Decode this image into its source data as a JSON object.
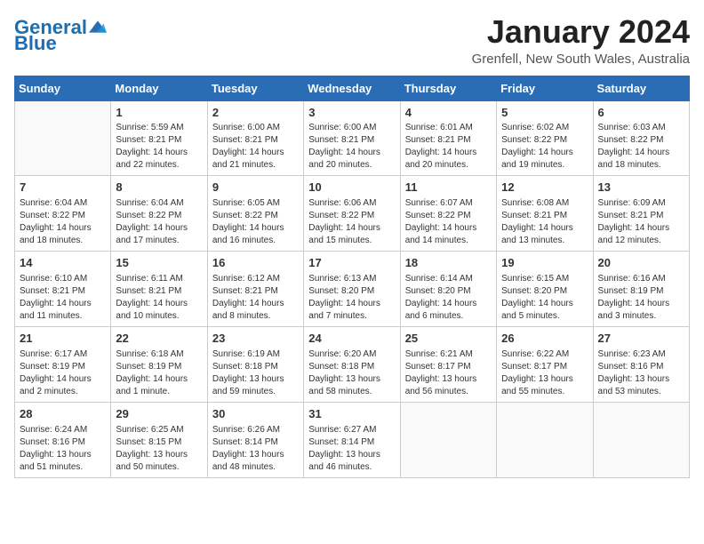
{
  "logo": {
    "line1": "General",
    "line2": "Blue"
  },
  "title": "January 2024",
  "subtitle": "Grenfell, New South Wales, Australia",
  "days_header": [
    "Sunday",
    "Monday",
    "Tuesday",
    "Wednesday",
    "Thursday",
    "Friday",
    "Saturday"
  ],
  "weeks": [
    [
      {
        "num": "",
        "text": ""
      },
      {
        "num": "1",
        "text": "Sunrise: 5:59 AM\nSunset: 8:21 PM\nDaylight: 14 hours\nand 22 minutes."
      },
      {
        "num": "2",
        "text": "Sunrise: 6:00 AM\nSunset: 8:21 PM\nDaylight: 14 hours\nand 21 minutes."
      },
      {
        "num": "3",
        "text": "Sunrise: 6:00 AM\nSunset: 8:21 PM\nDaylight: 14 hours\nand 20 minutes."
      },
      {
        "num": "4",
        "text": "Sunrise: 6:01 AM\nSunset: 8:21 PM\nDaylight: 14 hours\nand 20 minutes."
      },
      {
        "num": "5",
        "text": "Sunrise: 6:02 AM\nSunset: 8:22 PM\nDaylight: 14 hours\nand 19 minutes."
      },
      {
        "num": "6",
        "text": "Sunrise: 6:03 AM\nSunset: 8:22 PM\nDaylight: 14 hours\nand 18 minutes."
      }
    ],
    [
      {
        "num": "7",
        "text": "Sunrise: 6:04 AM\nSunset: 8:22 PM\nDaylight: 14 hours\nand 18 minutes."
      },
      {
        "num": "8",
        "text": "Sunrise: 6:04 AM\nSunset: 8:22 PM\nDaylight: 14 hours\nand 17 minutes."
      },
      {
        "num": "9",
        "text": "Sunrise: 6:05 AM\nSunset: 8:22 PM\nDaylight: 14 hours\nand 16 minutes."
      },
      {
        "num": "10",
        "text": "Sunrise: 6:06 AM\nSunset: 8:22 PM\nDaylight: 14 hours\nand 15 minutes."
      },
      {
        "num": "11",
        "text": "Sunrise: 6:07 AM\nSunset: 8:22 PM\nDaylight: 14 hours\nand 14 minutes."
      },
      {
        "num": "12",
        "text": "Sunrise: 6:08 AM\nSunset: 8:21 PM\nDaylight: 14 hours\nand 13 minutes."
      },
      {
        "num": "13",
        "text": "Sunrise: 6:09 AM\nSunset: 8:21 PM\nDaylight: 14 hours\nand 12 minutes."
      }
    ],
    [
      {
        "num": "14",
        "text": "Sunrise: 6:10 AM\nSunset: 8:21 PM\nDaylight: 14 hours\nand 11 minutes."
      },
      {
        "num": "15",
        "text": "Sunrise: 6:11 AM\nSunset: 8:21 PM\nDaylight: 14 hours\nand 10 minutes."
      },
      {
        "num": "16",
        "text": "Sunrise: 6:12 AM\nSunset: 8:21 PM\nDaylight: 14 hours\nand 8 minutes."
      },
      {
        "num": "17",
        "text": "Sunrise: 6:13 AM\nSunset: 8:20 PM\nDaylight: 14 hours\nand 7 minutes."
      },
      {
        "num": "18",
        "text": "Sunrise: 6:14 AM\nSunset: 8:20 PM\nDaylight: 14 hours\nand 6 minutes."
      },
      {
        "num": "19",
        "text": "Sunrise: 6:15 AM\nSunset: 8:20 PM\nDaylight: 14 hours\nand 5 minutes."
      },
      {
        "num": "20",
        "text": "Sunrise: 6:16 AM\nSunset: 8:19 PM\nDaylight: 14 hours\nand 3 minutes."
      }
    ],
    [
      {
        "num": "21",
        "text": "Sunrise: 6:17 AM\nSunset: 8:19 PM\nDaylight: 14 hours\nand 2 minutes."
      },
      {
        "num": "22",
        "text": "Sunrise: 6:18 AM\nSunset: 8:19 PM\nDaylight: 14 hours\nand 1 minute."
      },
      {
        "num": "23",
        "text": "Sunrise: 6:19 AM\nSunset: 8:18 PM\nDaylight: 13 hours\nand 59 minutes."
      },
      {
        "num": "24",
        "text": "Sunrise: 6:20 AM\nSunset: 8:18 PM\nDaylight: 13 hours\nand 58 minutes."
      },
      {
        "num": "25",
        "text": "Sunrise: 6:21 AM\nSunset: 8:17 PM\nDaylight: 13 hours\nand 56 minutes."
      },
      {
        "num": "26",
        "text": "Sunrise: 6:22 AM\nSunset: 8:17 PM\nDaylight: 13 hours\nand 55 minutes."
      },
      {
        "num": "27",
        "text": "Sunrise: 6:23 AM\nSunset: 8:16 PM\nDaylight: 13 hours\nand 53 minutes."
      }
    ],
    [
      {
        "num": "28",
        "text": "Sunrise: 6:24 AM\nSunset: 8:16 PM\nDaylight: 13 hours\nand 51 minutes."
      },
      {
        "num": "29",
        "text": "Sunrise: 6:25 AM\nSunset: 8:15 PM\nDaylight: 13 hours\nand 50 minutes."
      },
      {
        "num": "30",
        "text": "Sunrise: 6:26 AM\nSunset: 8:14 PM\nDaylight: 13 hours\nand 48 minutes."
      },
      {
        "num": "31",
        "text": "Sunrise: 6:27 AM\nSunset: 8:14 PM\nDaylight: 13 hours\nand 46 minutes."
      },
      {
        "num": "",
        "text": ""
      },
      {
        "num": "",
        "text": ""
      },
      {
        "num": "",
        "text": ""
      }
    ]
  ]
}
